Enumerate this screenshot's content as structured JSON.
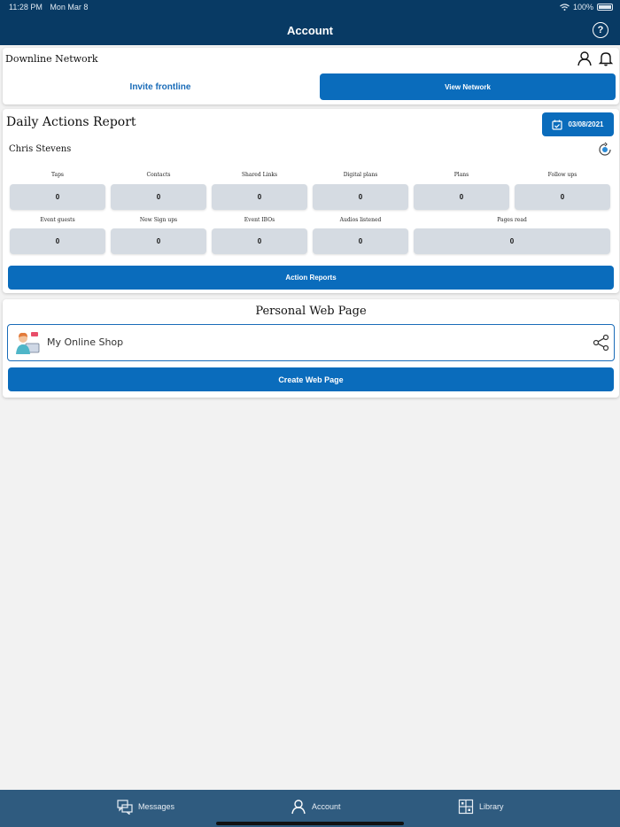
{
  "status_bar": {
    "time": "11:28 PM",
    "date": "Mon Mar 8",
    "battery": "100%"
  },
  "header": {
    "title": "Account",
    "help_icon": "question-circle-icon"
  },
  "downline": {
    "title": "Downline Network",
    "tabs": {
      "invite": "Invite frontline",
      "view": "View Network"
    }
  },
  "daily_report": {
    "title": "Daily Actions Report",
    "date": "03/08/2021",
    "user": "Chris Stevens",
    "metrics": [
      {
        "label": "Taps",
        "value": "0"
      },
      {
        "label": "Contacts",
        "value": "0"
      },
      {
        "label": "Shared Links",
        "value": "0"
      },
      {
        "label": "Digital plans",
        "value": "0"
      },
      {
        "label": "Plans",
        "value": "0"
      },
      {
        "label": "Follow ups",
        "value": "0"
      },
      {
        "label": "Event guests",
        "value": "0"
      },
      {
        "label": "New Sign ups",
        "value": "0"
      },
      {
        "label": "Event IBOs",
        "value": "0"
      },
      {
        "label": "Audios listened",
        "value": "0"
      },
      {
        "label": "Pages read",
        "value": "0"
      }
    ],
    "action_button": "Action Reports"
  },
  "web_page": {
    "title": "Personal Web Page",
    "shop_label": "My Online Shop",
    "create_button": "Create Web Page"
  },
  "tabbar": {
    "messages": "Messages",
    "account": "Account",
    "library": "Library"
  },
  "colors": {
    "primary": "#0a6cbc",
    "header": "#083a64",
    "tabbar": "#2f5b7f"
  }
}
